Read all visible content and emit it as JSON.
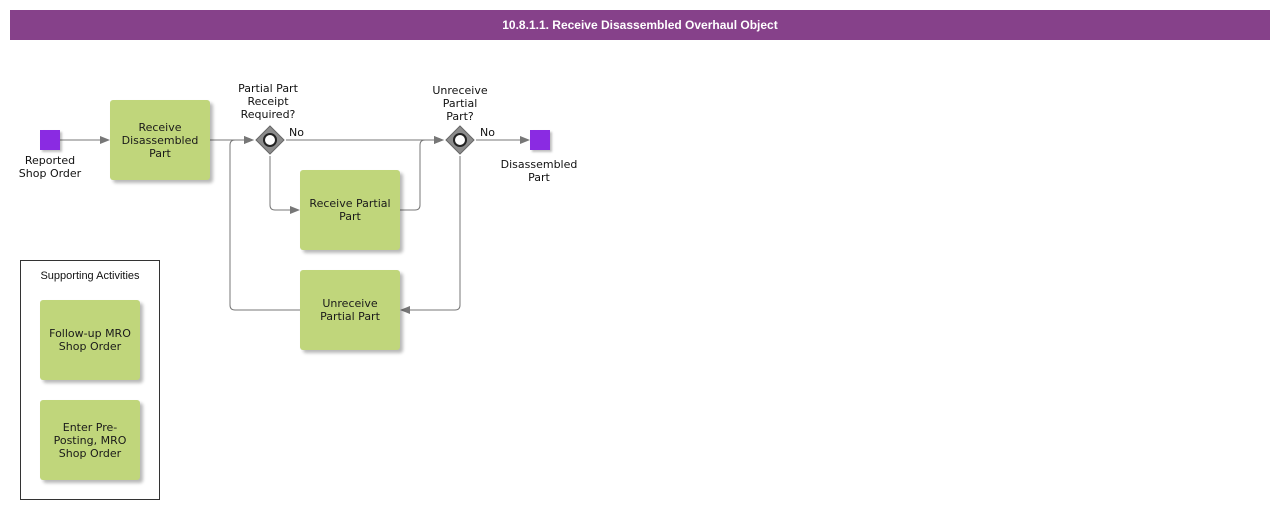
{
  "title": "10.8.1.1. Receive Disassembled Overhaul Object",
  "colors": {
    "title_bar": "#86418a",
    "task_fill": "#c0d67b",
    "event_fill": "#8a2be2",
    "gateway_fill": "#8c8c8c",
    "flow_line": "#777777"
  },
  "events": {
    "start_label": "Reported\nShop Order",
    "end_label": "Disassembled\nPart"
  },
  "tasks": {
    "receive_disassembled": "Receive\nDisassembled\nPart",
    "receive_partial": "Receive Partial\nPart",
    "unreceive_partial": "Unreceive\nPartial Part"
  },
  "gateways": {
    "g1_label": "Partial Part\nReceipt\nRequired?",
    "g1_no": "No",
    "g2_label": "Unreceive\nPartial\nPart?",
    "g2_no": "No"
  },
  "supporting": {
    "title": "Supporting Activities",
    "followup": "Follow-up MRO\nShop Order",
    "preposting": "Enter Pre-\nPosting, MRO\nShop Order"
  }
}
